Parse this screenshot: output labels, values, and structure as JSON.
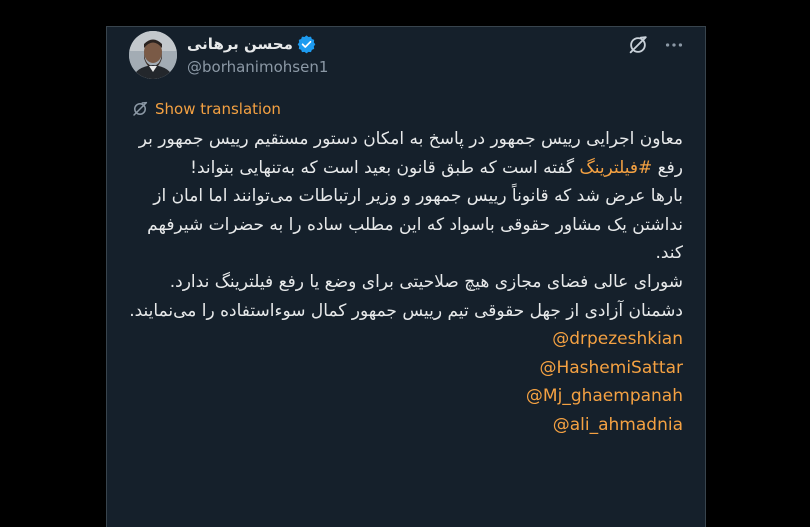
{
  "author": {
    "display_name": "محسن برهانی",
    "handle": "@borhanimohsen1",
    "verified": true
  },
  "actions": {
    "grok_icon": "grok-icon",
    "more_icon": "more-horizontal-icon"
  },
  "translation": {
    "label": "Show translation",
    "icon": "translate-icon"
  },
  "tweet": {
    "p1_before": "معاون اجرایی رییس جمهور در پاسخ به امکان دستور مستقیم رییس جمهور بر رفع ",
    "hashtag": "#فیلترینگ",
    "p1_after": " گفته است که طبق قانون بعید است که به‌تنهایی بتواند!",
    "p2": "بارها عرض شد که قانوناً رییس جمهور و وزیر ارتباطات می‌توانند اما امان از نداشتن یک مشاور حقوقی باسواد که این مطلب ساده را به حضرات شیرفهم کند.",
    "p3": "شورای عالی فضای مجازی هیچ صلاحیتی برای وضع یا رفع فیلترینگ ندارد.",
    "p4": "دشمنان آزادی از جهل حقوقی تیم رییس جمهور کمال سوءاستفاده را می‌نمایند.",
    "mentions": [
      "@drpezeshkian",
      "@HashemiSattar",
      "@Mj_ghaempanah",
      "@ali_ahmadnia"
    ]
  },
  "colors": {
    "background": "#000000",
    "card": "#15202b",
    "text": "#e7e9ea",
    "muted": "#8b98a5",
    "accent": "#f4a142",
    "verified": "#1d9bf0"
  }
}
